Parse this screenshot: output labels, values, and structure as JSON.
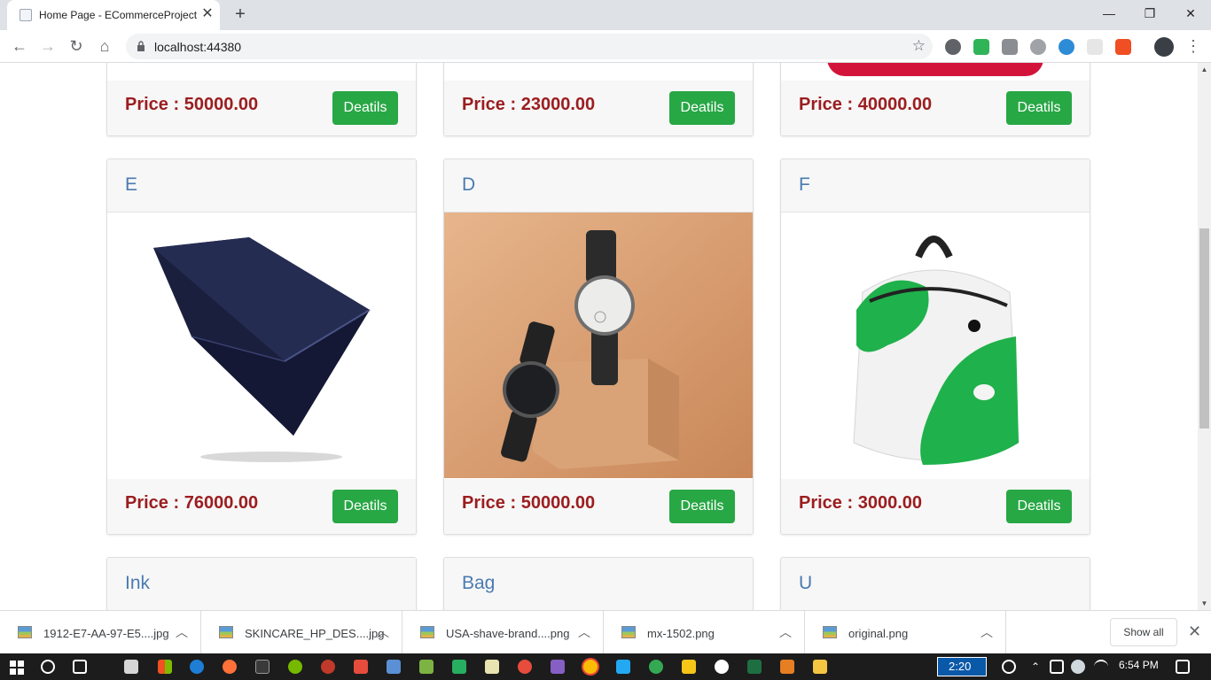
{
  "browser": {
    "tab_title": "Home Page - ECommerceProject",
    "tab_close": "✕",
    "new_tab": "+",
    "url": "localhost:44380",
    "controls": {
      "minimize": "—",
      "restore": "❐",
      "close": "✕"
    }
  },
  "products_top": [
    {
      "price": "Price : 50000.00",
      "button": "Deatils"
    },
    {
      "price": "Price : 23000.00",
      "button": "Deatils"
    },
    {
      "price": "Price : 40000.00",
      "button": "Deatils"
    }
  ],
  "products_middle": [
    {
      "name": "E",
      "price": "Price : 76000.00",
      "button": "Deatils",
      "image": "laptop"
    },
    {
      "name": "D",
      "price": "Price : 50000.00",
      "button": "Deatils",
      "image": "watches"
    },
    {
      "name": "F",
      "price": "Price : 3000.00",
      "button": "Deatils",
      "image": "backpack"
    }
  ],
  "products_bottom": [
    {
      "name": "Ink"
    },
    {
      "name": "Bag"
    },
    {
      "name": "U"
    }
  ],
  "downloads": {
    "items": [
      {
        "name": "1912-E7-AA-97-E5....jpg"
      },
      {
        "name": "SKINCARE_HP_DES....jpg"
      },
      {
        "name": "USA-shave-brand....png"
      },
      {
        "name": "mx-1502.png"
      },
      {
        "name": "original.png"
      }
    ],
    "show_all": "Show all"
  },
  "taskbar": {
    "time": "6:54 PM",
    "box_text": "2:20"
  },
  "colors": {
    "accent_button": "#28a745",
    "price_text": "#9b1d1f",
    "title_text": "#4a7bb1"
  }
}
